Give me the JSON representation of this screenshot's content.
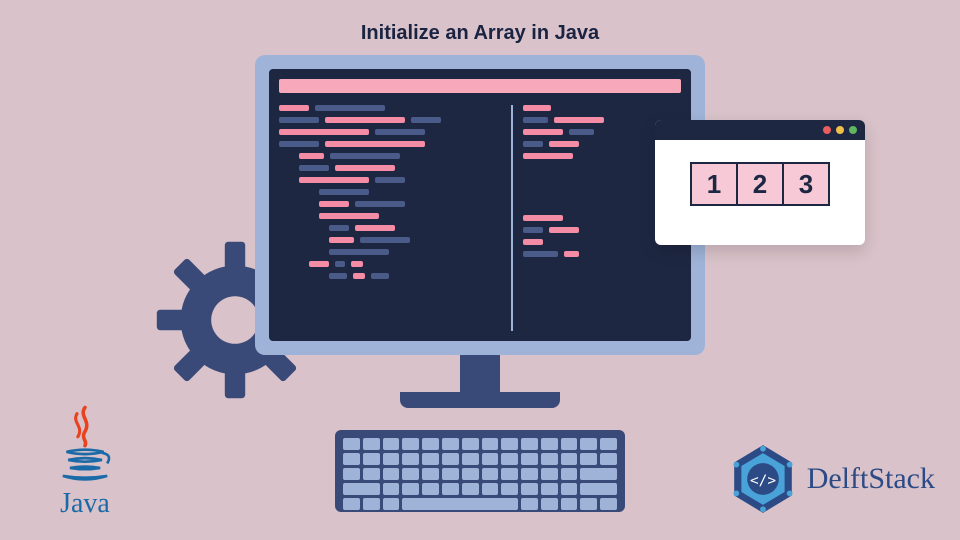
{
  "title": "Initialize an Array in Java",
  "array_cells": [
    "1",
    "2",
    "3"
  ],
  "logos": {
    "java": "Java",
    "delftstack": "DelftStack"
  },
  "colors": {
    "background": "#d9c2c9",
    "monitor_frame": "#9fb3d8",
    "screen": "#1e2742",
    "code_pink": "#f58ca5",
    "code_blue": "#4a5b8a",
    "gear": "#3a4a78",
    "cell_fill": "#f7c9d6",
    "java_blue": "#1a6aa8",
    "delft_blue": "#2c4a85"
  }
}
